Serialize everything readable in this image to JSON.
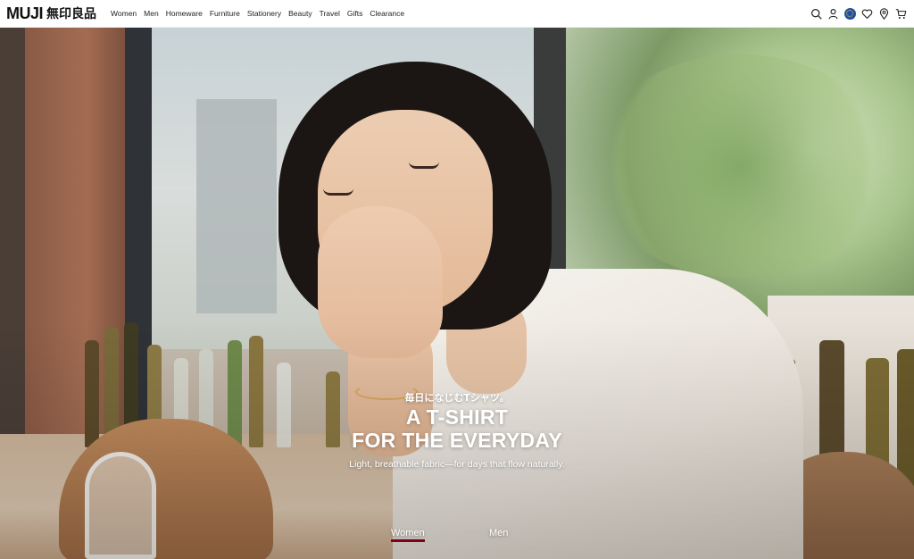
{
  "header": {
    "logo_latin": "MUJI",
    "logo_jp": "無印良品",
    "nav": [
      "Women",
      "Men",
      "Homeware",
      "Furniture",
      "Stationery",
      "Beauty",
      "Travel",
      "Gifts",
      "Clearance"
    ],
    "icons": [
      "search-icon",
      "account-icon",
      "region-flag-icon",
      "wishlist-heart-icon",
      "store-locator-icon",
      "cart-icon"
    ]
  },
  "hero": {
    "kicker_jp": "毎日になじむTシャツ。",
    "headline_line1": "A T-SHIRT",
    "headline_line2": "FOR THE EVERYDAY",
    "subtitle": "Light, breathable fabric—for days that flow naturally.",
    "tabs": [
      {
        "label": "Women",
        "active": true
      },
      {
        "label": "Men",
        "active": false
      }
    ],
    "accent_color": "#7f0019"
  }
}
